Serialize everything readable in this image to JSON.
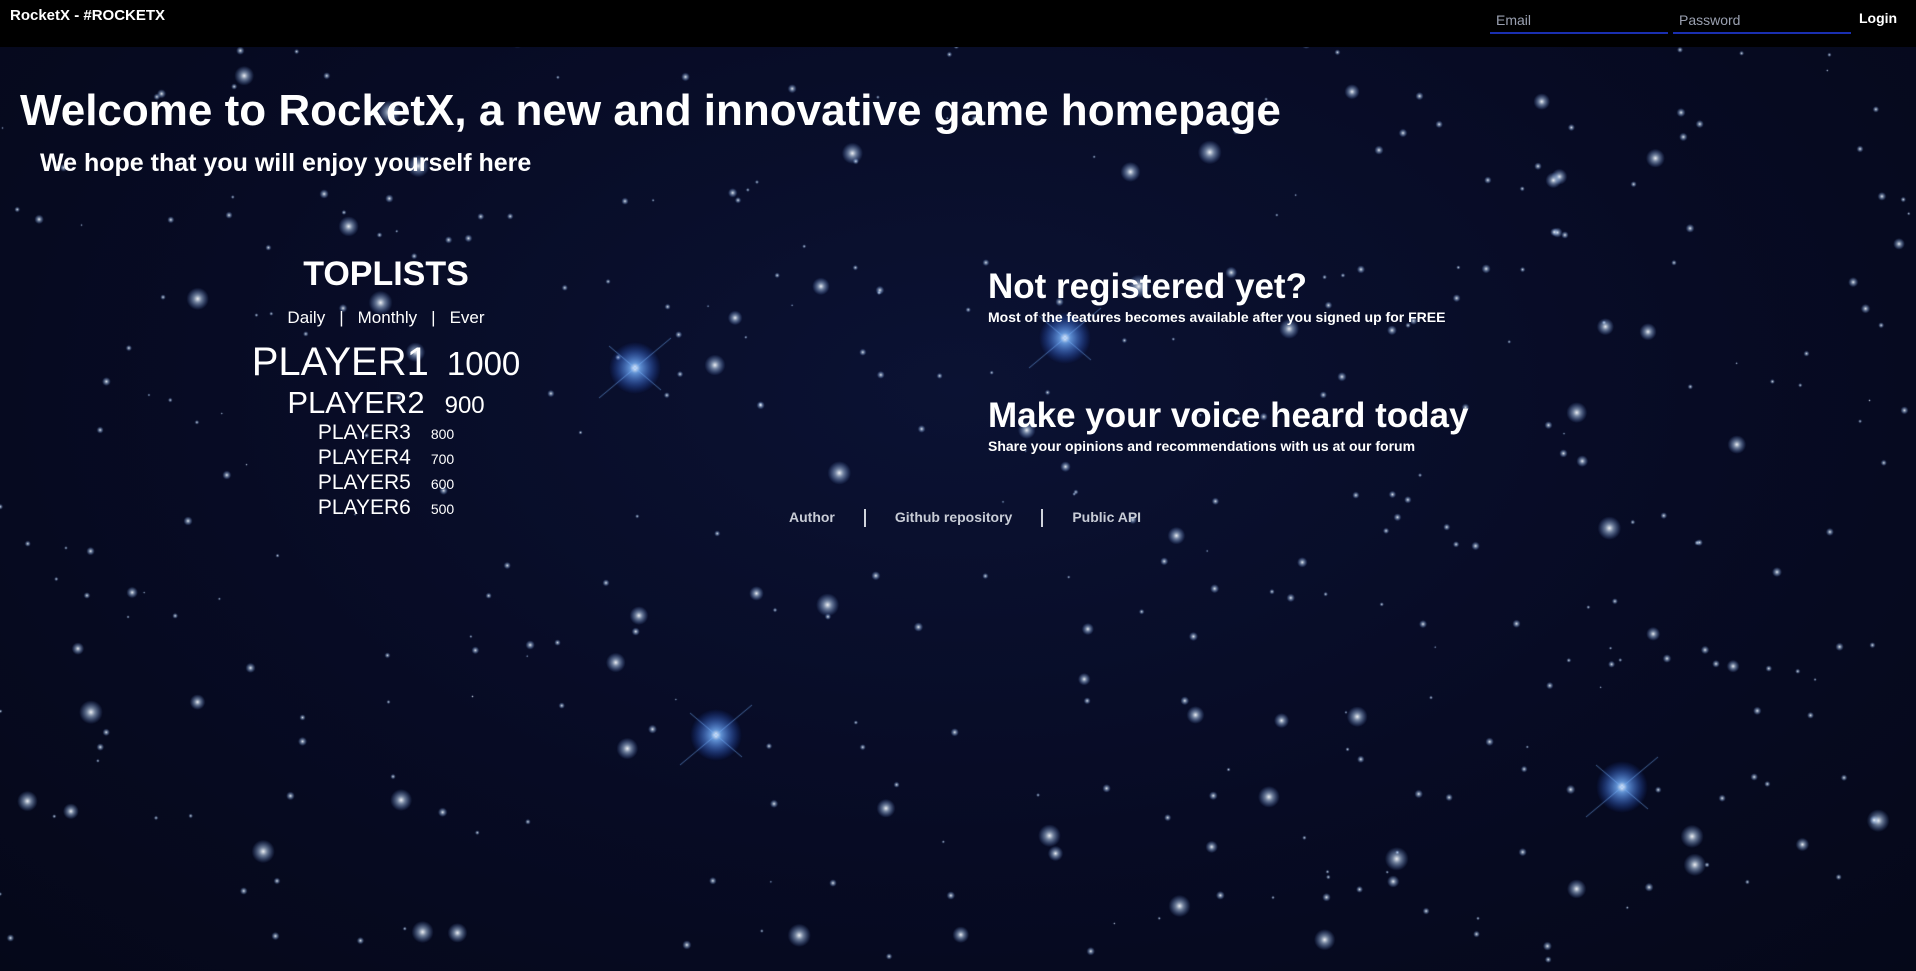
{
  "header": {
    "brand": "RocketX - #ROCKETX",
    "email_placeholder": "Email",
    "password_placeholder": "Password",
    "login_label": "Login"
  },
  "hero": {
    "title": "Welcome to RocketX, a new and innovative game homepage",
    "subtitle": "We hope that you will enjoy yourself here"
  },
  "toplists": {
    "title": "TOPLISTS",
    "tabs": [
      "Daily",
      "Monthly",
      "Ever"
    ],
    "separator": "|",
    "players": [
      {
        "name": "PLAYER1",
        "score": "1000"
      },
      {
        "name": "PLAYER2",
        "score": "900"
      },
      {
        "name": "PLAYER3",
        "score": "800"
      },
      {
        "name": "PLAYER4",
        "score": "700"
      },
      {
        "name": "PLAYER5",
        "score": "600"
      },
      {
        "name": "PLAYER6",
        "score": "500"
      }
    ]
  },
  "promos": [
    {
      "title": "Not registered yet?",
      "text": "Most of the features becomes available after you signed up for FREE"
    },
    {
      "title": "Make your voice heard today",
      "text": "Share your opinions and recommendations with us at our forum"
    }
  ],
  "footer": {
    "links": [
      "Author",
      "Github repository",
      "Public API"
    ]
  },
  "colors": {
    "background": "#070b24",
    "topbar": "#000000",
    "input_underline": "#1a2fb0",
    "star_glow": "#2f7bff"
  }
}
